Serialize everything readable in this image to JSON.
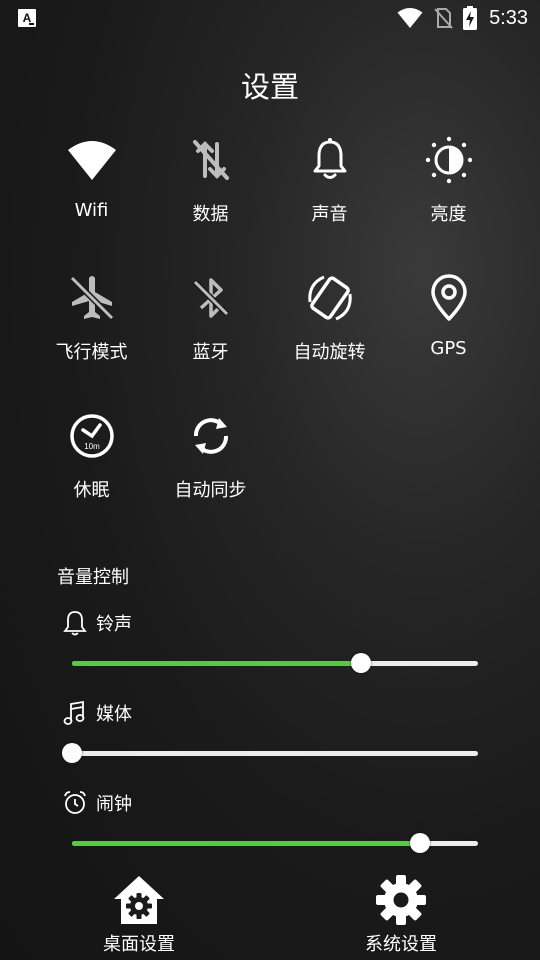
{
  "status_bar": {
    "time": "5:33",
    "icons": [
      "app-notification-icon",
      "wifi-icon",
      "no-sim-icon",
      "battery-charging-icon"
    ]
  },
  "title": "设置",
  "toggles": [
    {
      "id": "wifi",
      "label": "Wifi",
      "icon": "wifi-icon"
    },
    {
      "id": "data",
      "label": "数据",
      "icon": "mobile-data-off-icon"
    },
    {
      "id": "sound",
      "label": "声音",
      "icon": "bell-icon"
    },
    {
      "id": "brightness",
      "label": "亮度",
      "icon": "brightness-icon"
    },
    {
      "id": "airplane",
      "label": "飞行模式",
      "icon": "airplane-off-icon"
    },
    {
      "id": "bluetooth",
      "label": "蓝牙",
      "icon": "bluetooth-off-icon"
    },
    {
      "id": "rotate",
      "label": "自动旋转",
      "icon": "screen-rotation-icon"
    },
    {
      "id": "gps",
      "label": "GPS",
      "icon": "location-pin-icon"
    },
    {
      "id": "sleep",
      "label": "休眠",
      "icon": "sleep-timer-icon",
      "badge": "10m"
    },
    {
      "id": "sync",
      "label": "自动同步",
      "icon": "sync-icon"
    }
  ],
  "volume": {
    "title": "音量控制",
    "controls": [
      {
        "id": "ringtone",
        "label": "铃声",
        "icon": "bell-outline-icon",
        "level": 0.713
      },
      {
        "id": "media",
        "label": "媒体",
        "icon": "music-note-icon",
        "level": 0.0
      },
      {
        "id": "alarm",
        "label": "闹钟",
        "icon": "alarm-clock-icon",
        "level": 0.857
      }
    ]
  },
  "bottom": {
    "desktop_settings": "桌面设置",
    "system_settings": "系统设置"
  },
  "colors": {
    "accent": "#4cd137",
    "track": "#ececec",
    "text": "#ffffff"
  }
}
